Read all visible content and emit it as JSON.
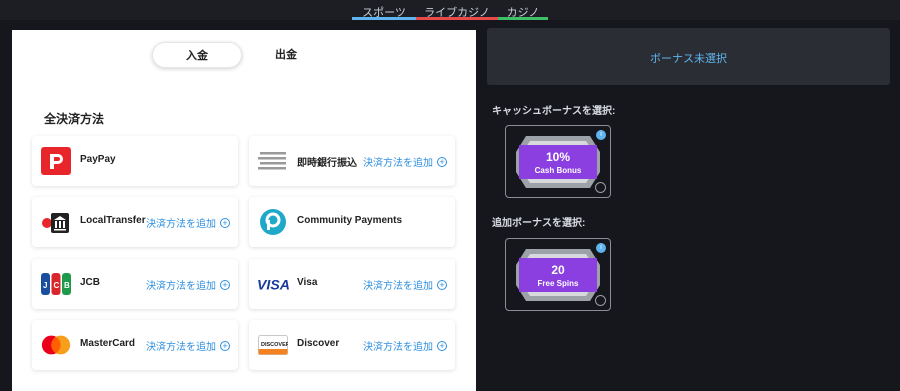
{
  "nav": {
    "tabs": [
      {
        "label": "スポーツ",
        "color": "#5fb3ee"
      },
      {
        "label": "ライブカジノ",
        "color": "#e84a4a"
      },
      {
        "label": "カジノ",
        "color": "#3fbf6a"
      }
    ]
  },
  "payment": {
    "deposit_label": "入金",
    "withdraw_label": "出金",
    "section_title": "全決済方法",
    "add_label": "決済方法を追加",
    "methods": [
      {
        "name": "PayPay",
        "icon": "paypay-icon"
      },
      {
        "name": "即時銀行振込",
        "icon": "bank-transfer-icon"
      },
      {
        "name": "LocalTransfer",
        "icon": "local-transfer-icon"
      },
      {
        "name": "Community Payments",
        "icon": "community-payments-icon"
      },
      {
        "name": "JCB",
        "icon": "jcb-icon"
      },
      {
        "name": "Visa",
        "icon": "visa-icon"
      },
      {
        "name": "MasterCard",
        "icon": "mastercard-icon"
      },
      {
        "name": "Discover",
        "icon": "discover-icon"
      }
    ]
  },
  "bonus": {
    "none_selected": "ボーナス未選択",
    "cash_label": "キャッシュボーナスを選択:",
    "extra_label": "追加ボーナスを選択:",
    "cash_tile": {
      "big": "10%",
      "small": "Cash Bonus"
    },
    "extra_tile": {
      "big": "20",
      "small": "Free Spins"
    },
    "info_glyph": "i"
  }
}
